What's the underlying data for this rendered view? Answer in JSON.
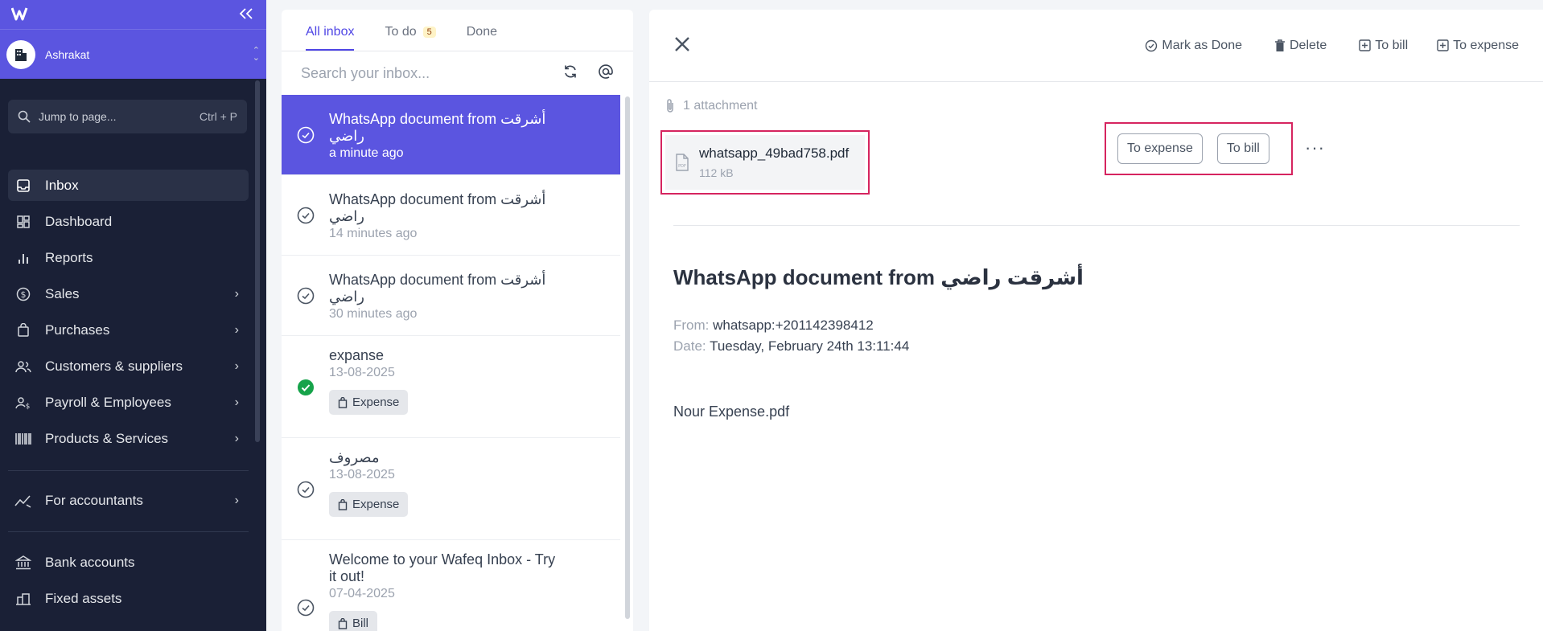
{
  "sidebar": {
    "workspace_name": "Ashrakat",
    "jump_label": "Jump to page...",
    "jump_shortcut": "Ctrl + P",
    "items": [
      {
        "label": "Inbox"
      },
      {
        "label": "Dashboard"
      },
      {
        "label": "Reports"
      },
      {
        "label": "Sales"
      },
      {
        "label": "Purchases"
      },
      {
        "label": "Customers & suppliers"
      },
      {
        "label": "Payroll & Employees"
      },
      {
        "label": "Products & Services"
      },
      {
        "label": "For accountants"
      },
      {
        "label": "Bank accounts"
      },
      {
        "label": "Fixed assets"
      }
    ]
  },
  "inbox": {
    "tabs": [
      {
        "label": "All inbox"
      },
      {
        "label": "To do",
        "count": "5"
      },
      {
        "label": "Done"
      }
    ],
    "search_placeholder": "Search your inbox...",
    "items": [
      {
        "title": "WhatsApp document from أشرقت راضي",
        "time": "a minute ago"
      },
      {
        "title": "WhatsApp document from أشرقت راضي",
        "time": "14 minutes ago"
      },
      {
        "title": "WhatsApp document from أشرقت راضي",
        "time": "30 minutes ago"
      },
      {
        "title": "expanse",
        "time": "13-08-2025",
        "tag": "Expense"
      },
      {
        "title": "مصروف",
        "time": "13-08-2025",
        "tag": "Expense"
      },
      {
        "title": "Welcome to your Wafeq Inbox - Try it out!",
        "time": "07-04-2025",
        "tag": "Bill"
      }
    ]
  },
  "detail": {
    "actions": {
      "mark_done": "Mark as Done",
      "delete": "Delete",
      "to_bill": "To bill",
      "to_expense": "To expense"
    },
    "attachment_count": "1 attachment",
    "attachment": {
      "name": "whatsapp_49bad758.pdf",
      "size": "112 kB"
    },
    "attachment_buttons": {
      "to_expense": "To expense",
      "to_bill": "To bill"
    },
    "subject": "WhatsApp document from أشرقت راضي",
    "from_label": "From:",
    "from_value": "whatsapp:+201142398412",
    "date_label": "Date:",
    "date_value": "Tuesday, February 24th 13:11:44",
    "body": "Nour Expense.pdf"
  },
  "colors": {
    "brand": "#5b55e0",
    "sidebar": "#1a2036",
    "highlight": "#d6245f",
    "done": "#16a34a"
  }
}
